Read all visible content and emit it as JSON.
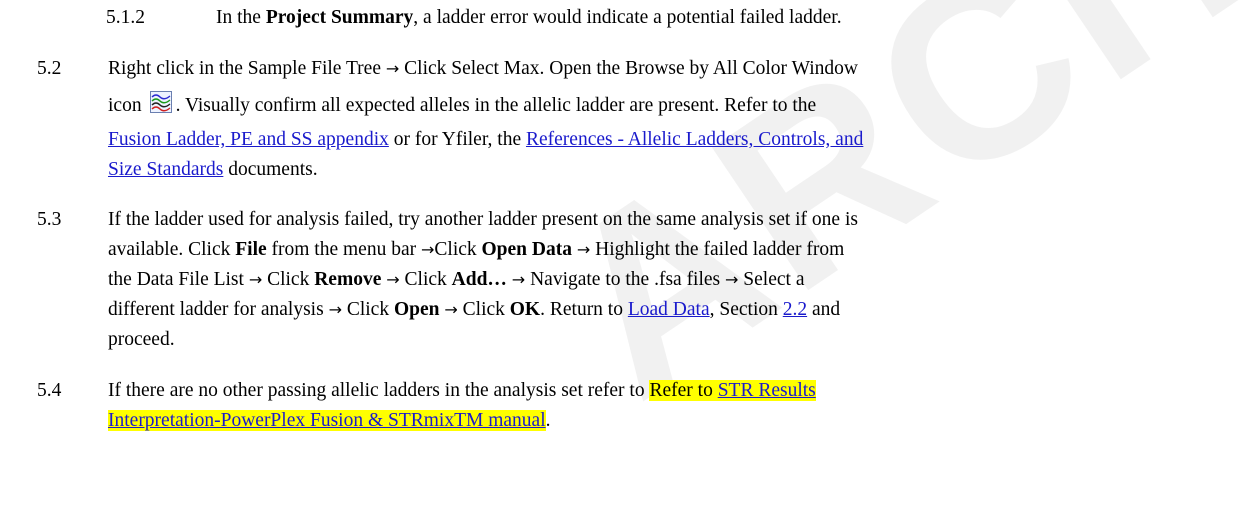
{
  "watermark": "ARCHIVED",
  "s512": {
    "num": "5.1.2",
    "t1": "In the ",
    "b1": "Project Summary",
    "t2": ", a ladder error would indicate a potential failed ladder."
  },
  "s52": {
    "num": "5.2",
    "t1": "Right click in the Sample File Tree ",
    "t2": " Click Select Max. Open the Browse by All Color Window",
    "t3": "icon",
    "icon": "browse-all-colors-icon",
    "t4": ". Visually confirm all expected alleles in the allelic ladder are present. Refer to the",
    "link1": "Fusion Ladder, PE and SS appendix",
    "t5": " or for Yfiler, the ",
    "link2a": "References - Allelic Ladders, Controls, and",
    "link2b": "Size Standards",
    "t6": " documents."
  },
  "s53": {
    "num": "5.3",
    "l1": "If the ladder used for analysis failed, try another ladder present on the same analysis set if one is",
    "l2a": "available. Click ",
    "l2b": "File",
    "l2c": " from the menu bar ",
    "l2d": "Click ",
    "l2e": "Open Data",
    "l2f": " Highlight the failed ladder from",
    "l3a": "the Data File List ",
    "l3b": " Click ",
    "l3c": "Remove",
    "l3d": " Click ",
    "l3e": "Add…",
    "l3f": " Navigate to the .fsa files ",
    "l3g": " Select a",
    "l4a": "different ladder for analysis ",
    "l4b": " Click ",
    "l4c": "Open",
    "l4d": " Click ",
    "l4e": "OK",
    "l4f": ". Return to ",
    "l4link1": "Load Data",
    "l4g": ", Section ",
    "l4link2": "2.2",
    "l4h": " and",
    "l5": "proceed."
  },
  "s54": {
    "num": "5.4",
    "l1a": "If there are no other passing allelic ladders in the analysis set refer to ",
    "l1hl": "Refer to",
    "l1sp": " ",
    "l1link": "STR Results",
    "l2link": "Interpretation-PowerPlex Fusion & STRmixTM manual",
    "l2end": "."
  },
  "arrow": "→"
}
